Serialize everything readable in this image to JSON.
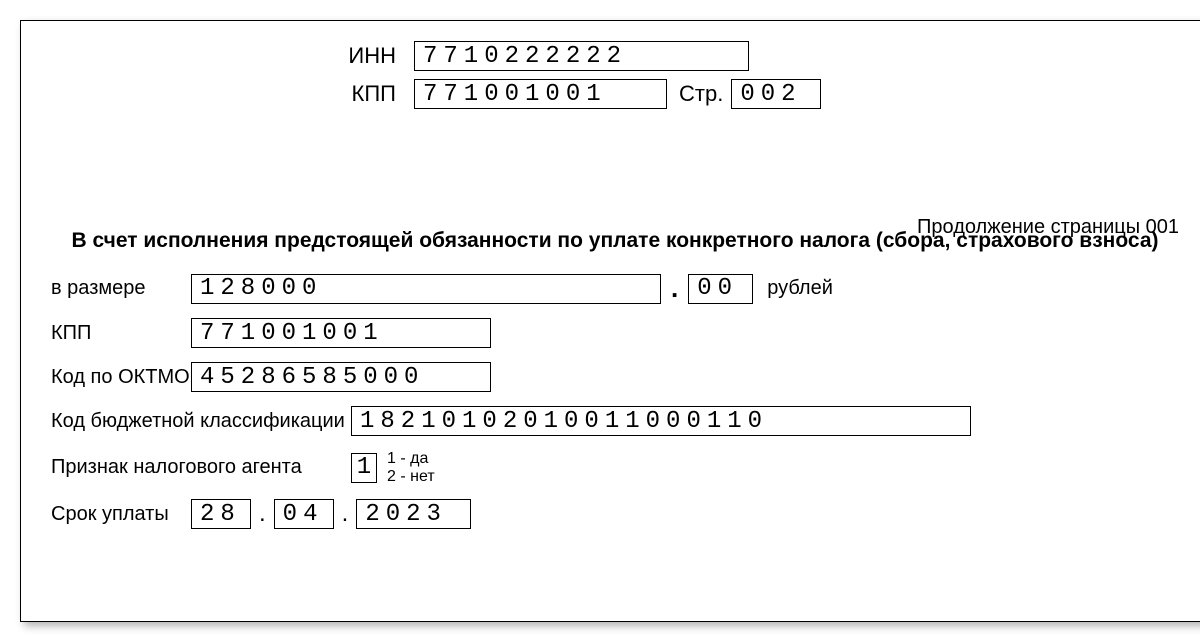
{
  "header": {
    "inn_label": "ИНН",
    "inn_value": "7710222222",
    "kpp_label": "КПП",
    "kpp_value": "771001001",
    "page_label": "Стр.",
    "page_value": "002"
  },
  "continuation": "Продолжение страницы 001",
  "section_title": "В счет исполнения предстоящей обязанности по уплате конкретного налога (сбора, страхового взноса)",
  "amount": {
    "label": "в размере",
    "value": "128000",
    "dot": ".",
    "kopecks": "00",
    "currency": "рублей"
  },
  "kpp2": {
    "label": "КПП",
    "value": "771001001"
  },
  "oktmo": {
    "label": "Код по ОКТМО",
    "value": "45286585000"
  },
  "kbk": {
    "label": "Код бюджетной классификации",
    "value": "18210102010011000110"
  },
  "agent": {
    "label": "Признак налогового агента",
    "value": "1",
    "legend1": "1 - да",
    "legend2": "2 - нет"
  },
  "due_date": {
    "label": "Срок уплаты",
    "day": "28",
    "month": "04",
    "year": "2023",
    "sep": "."
  }
}
